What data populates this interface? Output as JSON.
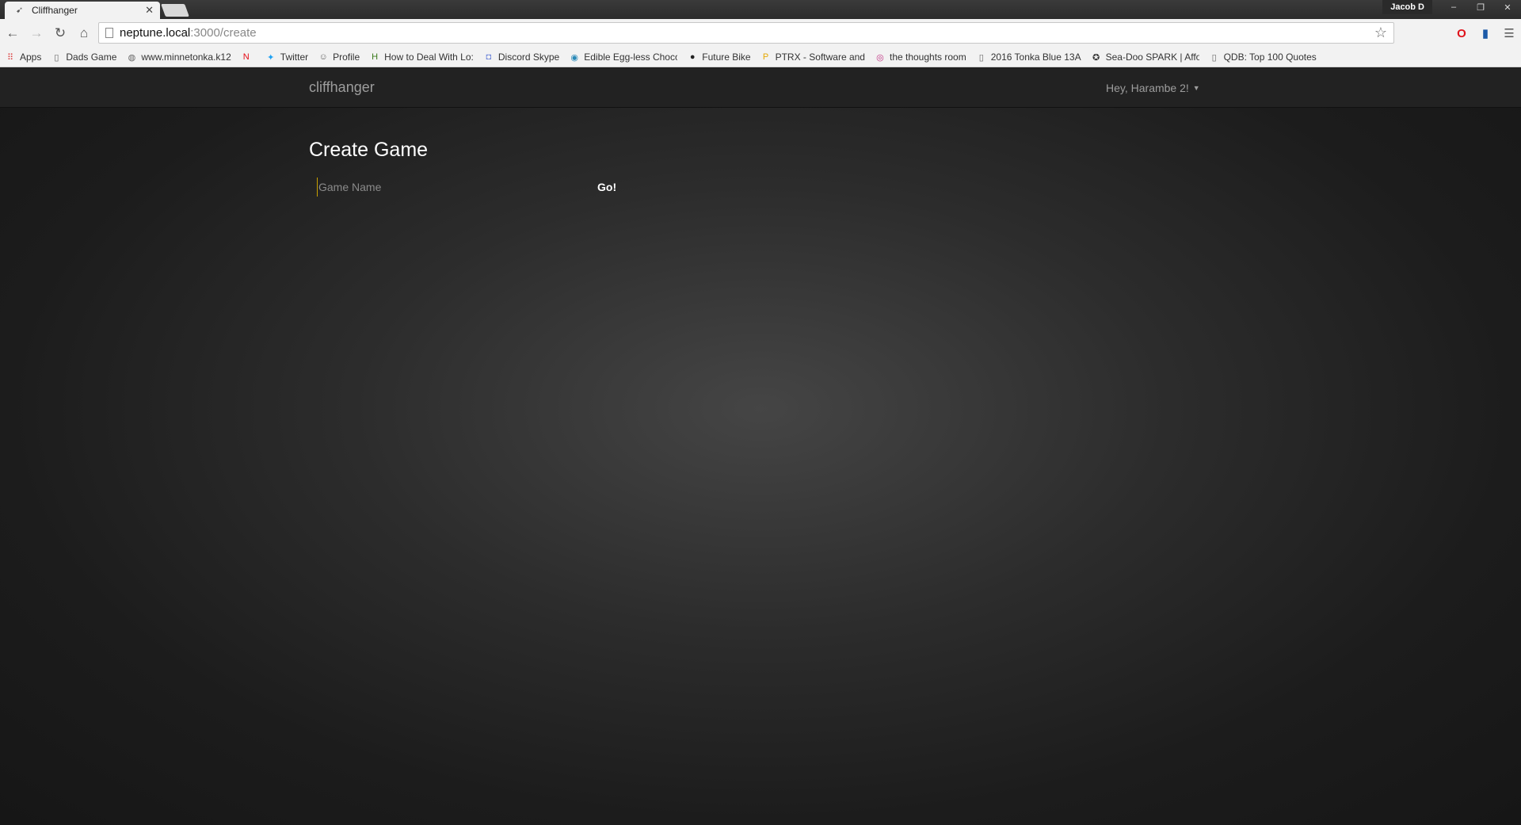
{
  "browser": {
    "tab": {
      "title": "Cliffhanger",
      "close": "✕"
    },
    "profile": "Jacob D",
    "window_controls": [
      "–",
      "❐",
      "✕"
    ],
    "address": {
      "host": "neptune.local",
      "path": ":3000/create"
    },
    "bookmarks": [
      {
        "label": "Apps",
        "icon": "apps-grid-icon"
      },
      {
        "label": "Dads Game",
        "icon": "page-icon"
      },
      {
        "label": "www.minnetonka.k12",
        "icon": "globe-icon"
      },
      {
        "label": "",
        "icon": "netflix-icon"
      },
      {
        "label": "Twitter",
        "icon": "twitter-icon"
      },
      {
        "label": "Profile",
        "icon": "profile-icon"
      },
      {
        "label": "How to Deal With Lo:",
        "icon": "wikihow-icon"
      },
      {
        "label": "Discord Skype",
        "icon": "discord-icon"
      },
      {
        "label": "Edible Egg-less Choco",
        "icon": "site-icon"
      },
      {
        "label": "Future Bike",
        "icon": "bike-icon"
      },
      {
        "label": "PTRX - Software and",
        "icon": "ptrx-icon"
      },
      {
        "label": "the thoughts room",
        "icon": "instagram-icon"
      },
      {
        "label": "2016 Tonka Blue 13A",
        "icon": "page-icon"
      },
      {
        "label": "Sea-Doo SPARK | Affo",
        "icon": "seadoo-icon"
      },
      {
        "label": "QDB: Top 100 Quotes",
        "icon": "page-icon"
      }
    ]
  },
  "navbar": {
    "brand": "cliffhanger",
    "user_greeting": "Hey, Harambe 2!"
  },
  "main": {
    "title": "Create Game",
    "game_name_placeholder": "Game Name",
    "submit_label": "Go!"
  }
}
